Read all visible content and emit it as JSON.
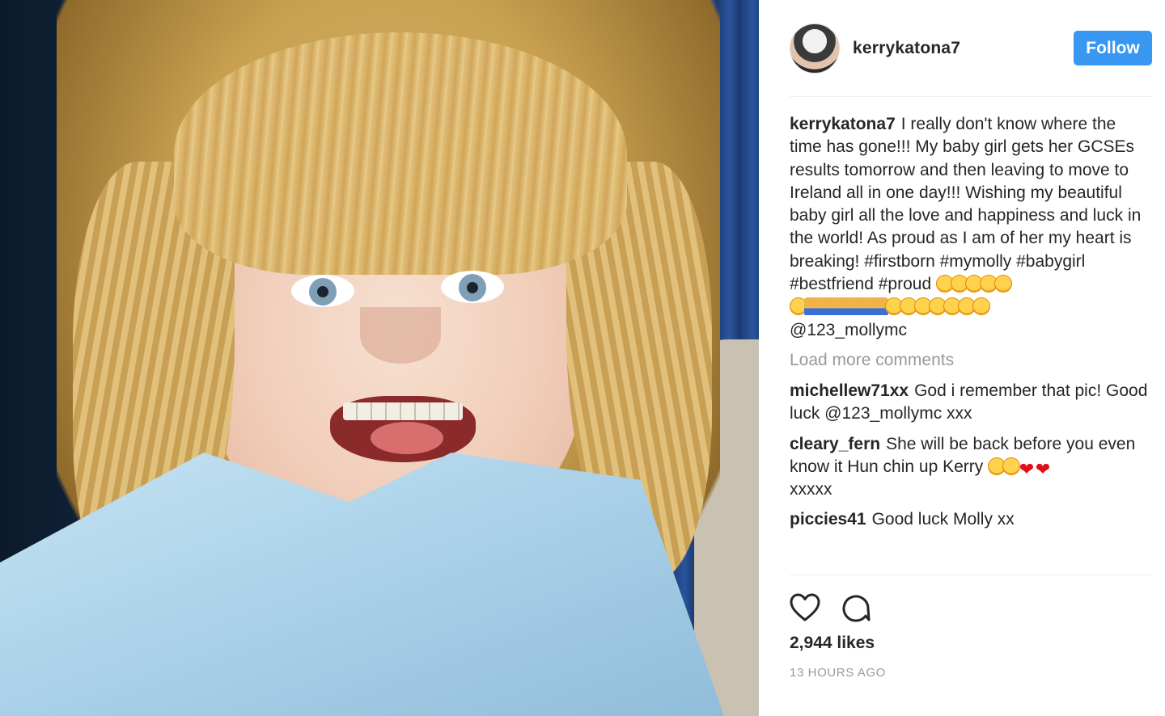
{
  "post": {
    "author": "kerrykatona7",
    "follow_label": "Follow",
    "caption": {
      "user": "kerrykatona7",
      "text": "I really don't know where the time has gone!!! My baby girl gets her GCSEs results tomorrow and then leaving to move to Ireland all in one day!!! Wishing my beautiful baby girl all the love and happiness and luck in the world! As proud as I am of her my heart is breaking! #firstborn #mymolly #babygirl #bestfriend #proud",
      "emoji_line_1": [
        "kiss",
        "kiss",
        "kiss",
        "kiss",
        "kiss"
      ],
      "emoji_line_2": [
        "kiss",
        "pray",
        "pray",
        "pray",
        "pray",
        "pray",
        "kiss",
        "kiss",
        "kiss",
        "kiss",
        "kiss",
        "kiss",
        "kiss"
      ],
      "mention": "@123_mollymc"
    },
    "load_more": "Load more comments",
    "comments": [
      {
        "user": "michellew71xx",
        "text": "God i remember that pic! Good luck @123_mollymc xxx"
      },
      {
        "user": "cleary_fern",
        "text": "She will be back before you even know it Hun chin up Kerry",
        "tail": "xxxxx"
      },
      {
        "user": "piccies41",
        "text": "Good luck Molly xx"
      },
      {
        "user": "",
        "text": ""
      }
    ],
    "likes": "2,944 likes",
    "time_ago": "13 HOURS AGO",
    "icons": {
      "like": "heart-outline-icon",
      "comment": "speech-bubble-icon"
    }
  },
  "colors": {
    "follow_bg": "#3897f0",
    "muted": "#999999",
    "text": "#262626"
  }
}
